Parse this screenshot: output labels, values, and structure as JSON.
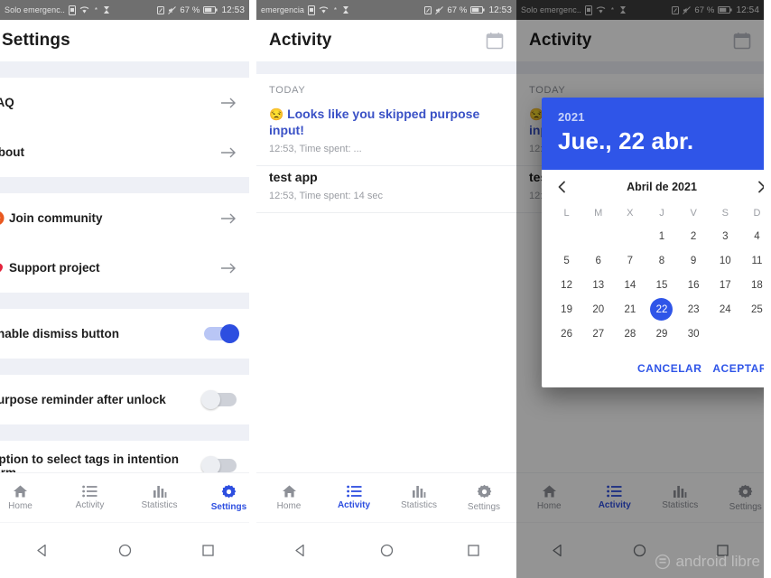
{
  "statusbar": {
    "carrier": "Solo emergenc..",
    "carrier_mid": "emergencia",
    "battery": "67 %",
    "time_1": "12:53",
    "time_2": "12:53",
    "time_3": "12:54"
  },
  "settings_screen": {
    "title": "Settings",
    "items": [
      {
        "label": "FAQ",
        "type": "link",
        "icon": "none"
      },
      {
        "label": "About",
        "type": "link",
        "icon": "none"
      },
      {
        "label": "Join community",
        "type": "link",
        "icon": "reddit-icon"
      },
      {
        "label": "Support project",
        "type": "link",
        "icon": "heart-icon"
      },
      {
        "label": "Enable dismiss button",
        "type": "toggle",
        "state": "on"
      },
      {
        "label": "Purpose reminder after unlock",
        "type": "toggle",
        "state": "off"
      },
      {
        "label": "Option to select tags in intention form",
        "type": "toggle",
        "state": "off"
      }
    ]
  },
  "activity_screen": {
    "title": "Activity",
    "section_label": "TODAY",
    "entries": [
      {
        "emoji": "😒",
        "title": "Looks like you skipped purpose input!",
        "subtitle": "12:53, Time spent: ...",
        "highlighted": true
      },
      {
        "emoji": "",
        "title": "test app",
        "subtitle": "12:53, Time spent: 14 sec",
        "highlighted": false
      }
    ]
  },
  "datepicker": {
    "year": "2021",
    "selected_date_label": "Jue., 22 abr.",
    "month_label": "Abril de 2021",
    "prev_label": "‹",
    "next_label": "›",
    "weekdays": [
      "L",
      "M",
      "X",
      "J",
      "V",
      "S",
      "D"
    ],
    "weeks": [
      [
        "",
        "",
        "",
        "1",
        "2",
        "3",
        "4"
      ],
      [
        "5",
        "6",
        "7",
        "8",
        "9",
        "10",
        "11"
      ],
      [
        "12",
        "13",
        "14",
        "15",
        "16",
        "17",
        "18"
      ],
      [
        "19",
        "20",
        "21",
        "22",
        "23",
        "24",
        "25"
      ],
      [
        "26",
        "27",
        "28",
        "29",
        "30",
        "",
        ""
      ]
    ],
    "selected_day": "22",
    "cancel_label": "CANCELAR",
    "accept_label": "ACEPTAR"
  },
  "bottomnav": {
    "items": [
      {
        "label": "Home",
        "icon": "home-icon"
      },
      {
        "label": "Activity",
        "icon": "list-icon"
      },
      {
        "label": "Statistics",
        "icon": "bar-chart-icon"
      },
      {
        "label": "Settings",
        "icon": "gear-icon"
      }
    ],
    "active_panel_1": "Settings",
    "active_panel_2": "Activity",
    "active_panel_3": "Activity"
  },
  "watermark": {
    "text": "android libre"
  },
  "colors": {
    "accent": "#2d4ee0",
    "dialog_blue": "#2f55e8",
    "section_bg": "#eef0f6"
  }
}
